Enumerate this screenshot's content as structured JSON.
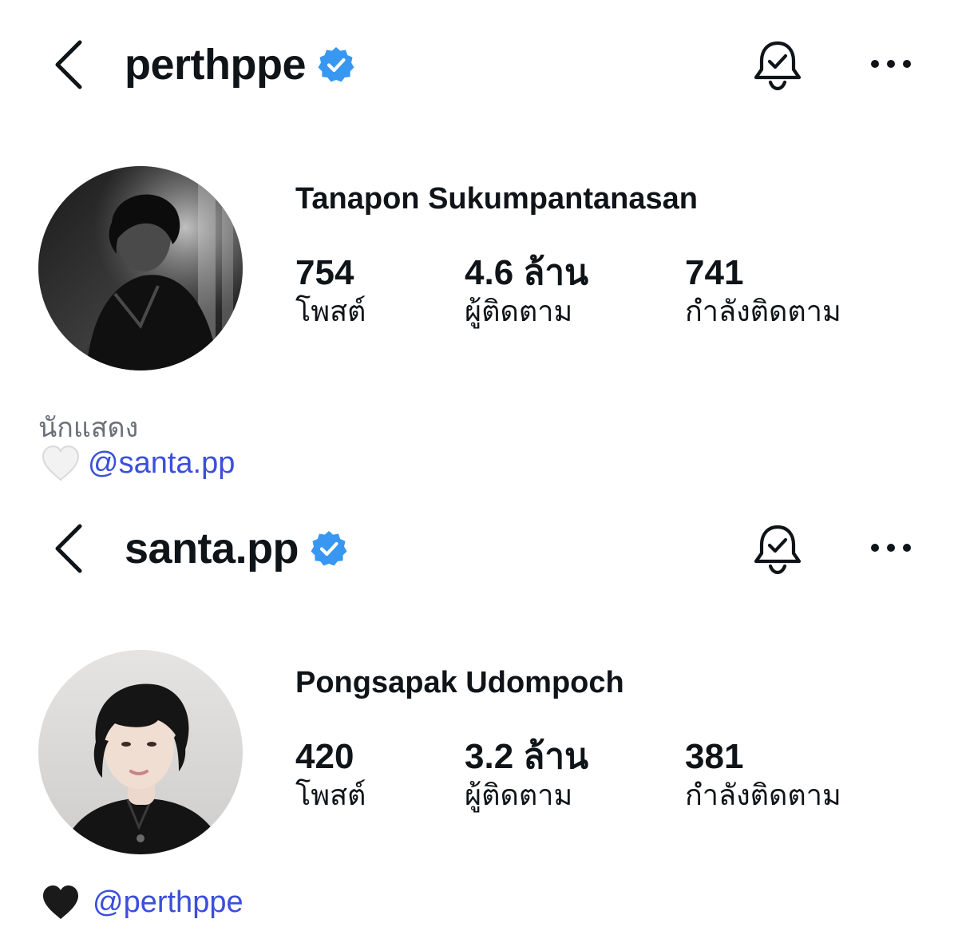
{
  "profiles": [
    {
      "username": "perthppe",
      "verified": true,
      "full_name": "Tanapon Sukumpantanasan",
      "stats": {
        "posts": {
          "value": "754",
          "label": "โพสต์"
        },
        "followers": {
          "value": "4.6 ล้าน",
          "label": "ผู้ติดตาม"
        },
        "following": {
          "value": "741",
          "label": "กำลังติดตาม"
        }
      },
      "bio": "นักแสดง",
      "mention": {
        "heart": "white-heart-icon",
        "handle": "@santa.pp"
      }
    },
    {
      "username": "santa.pp",
      "verified": true,
      "full_name": "Pongsapak Udompoch",
      "stats": {
        "posts": {
          "value": "420",
          "label": "โพสต์"
        },
        "followers": {
          "value": "3.2 ล้าน",
          "label": "ผู้ติดตาม"
        },
        "following": {
          "value": "381",
          "label": "กำลังติดตาม"
        }
      },
      "mention": {
        "heart": "black-heart-icon",
        "handle": "@perthppe"
      }
    }
  ],
  "icons": {
    "back": "chevron-left-icon",
    "verified": "verified-badge-icon",
    "notifications": "bell-check-icon",
    "more": "more-horizontal-icon"
  },
  "colors": {
    "verified_blue": "#3897f0",
    "link_blue": "#3b4fd9",
    "text_primary": "#0f1419",
    "text_secondary": "#6b7078"
  }
}
